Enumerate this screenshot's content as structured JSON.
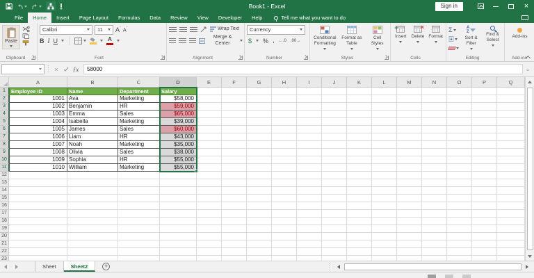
{
  "titlebar": {
    "title": "Book1 - Excel",
    "sign_in": "Sign in"
  },
  "tabs": [
    "File",
    "Home",
    "Insert",
    "Page Layout",
    "Formulas",
    "Data",
    "Review",
    "View",
    "Developer",
    "Help"
  ],
  "active_tab": "Home",
  "tell_me": "Tell me what you want to do",
  "ribbon": {
    "clipboard": {
      "label": "Clipboard",
      "paste": "Paste"
    },
    "font": {
      "label": "Font",
      "family": "Calibri",
      "size": "11",
      "bold": "B",
      "italic": "I",
      "underline": "U",
      "grow": "A",
      "shrink": "A",
      "color_a": "A"
    },
    "alignment": {
      "label": "Alignment",
      "wrap": "Wrap Text",
      "merge": "Merge & Center"
    },
    "number": {
      "label": "Number",
      "format": "Currency",
      "currency_symbol": "$",
      "percent": "%",
      "comma": ",",
      "inc_dec": "←.0",
      "dec_dec": ".00→"
    },
    "styles": {
      "label": "Styles",
      "conditional": "Conditional Formatting",
      "format_table": "Format as Table",
      "cell_styles": "Cell Styles"
    },
    "cells": {
      "label": "Cells",
      "insert": "Insert",
      "delete": "Delete",
      "format": "Format"
    },
    "editing": {
      "label": "Editing",
      "autosum": "Σ",
      "sort_filter": "Sort & Filter",
      "find_select": "Find & Select"
    },
    "addins": {
      "label": "Add-ins",
      "button": "Add-ins"
    }
  },
  "formula_bar": {
    "name_box": "",
    "fx": "ƒx",
    "value": "58000"
  },
  "grid": {
    "col_letters": [
      "A",
      "B",
      "C",
      "D",
      "E",
      "F",
      "G",
      "H",
      "I",
      "J",
      "K",
      "L",
      "M",
      "N",
      "O",
      "P",
      "Q"
    ],
    "row_count": 23,
    "headers": [
      "Employee ID",
      "Name",
      "Department",
      "Salary"
    ],
    "employees": [
      {
        "id": "1001",
        "name": "Ava",
        "department": "Marketing",
        "salary": "$58,000",
        "highlight": false
      },
      {
        "id": "1002",
        "name": "Benjamin",
        "department": "HR",
        "salary": "$59,000",
        "highlight": true
      },
      {
        "id": "1003",
        "name": "Emma",
        "department": "Sales",
        "salary": "$65,000",
        "highlight": true
      },
      {
        "id": "1004",
        "name": "Isabella",
        "department": "Marketing",
        "salary": "$39,000",
        "highlight": false
      },
      {
        "id": "1005",
        "name": "James",
        "department": "Sales",
        "salary": "$60,000",
        "highlight": true
      },
      {
        "id": "1006",
        "name": "Liam",
        "department": "HR",
        "salary": "$43,000",
        "highlight": false
      },
      {
        "id": "1007",
        "name": "Noah",
        "department": "Marketing",
        "salary": "$35,000",
        "highlight": false
      },
      {
        "id": "1008",
        "name": "Olivia",
        "department": "Sales",
        "salary": "$38,000",
        "highlight": false
      },
      {
        "id": "1009",
        "name": "Sophia",
        "department": "HR",
        "salary": "$55,000",
        "highlight": false
      },
      {
        "id": "1010",
        "name": "William",
        "department": "Marketing",
        "salary": "$55,000",
        "highlight": false
      }
    ],
    "selection": {
      "column": "D",
      "rows": "1-11",
      "active_cell_value": "58000"
    }
  },
  "sheet_tabs": [
    "Sheet",
    "Sheet2"
  ],
  "active_sheet": "Sheet2",
  "colors": {
    "excel_green": "#217346",
    "table_header_fill": "#6FAE4B",
    "bad_cell_fill": "#DCA0A9",
    "bad_cell_text": "#9C0006",
    "selection_fill": "#D9D9D9",
    "addin_orange": "#F2A33A"
  }
}
